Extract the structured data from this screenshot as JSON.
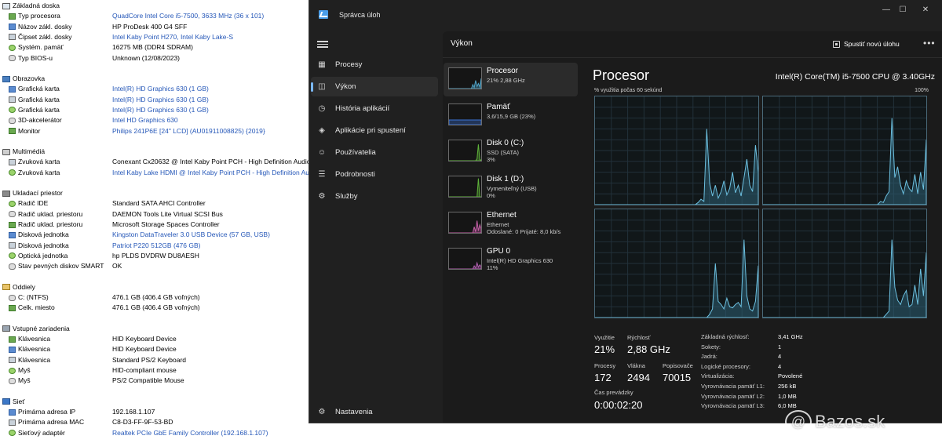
{
  "sysinfo": {
    "sections": [
      {
        "title": "Základná doska",
        "icon": "motherboard-icon",
        "props": [
          {
            "label": "Typ procesora",
            "value": "QuadCore Intel Core i5-7500, 3633 MHz (36 x 101)",
            "link": true
          },
          {
            "label": "Názov zákl. dosky",
            "value": "HP ProDesk 400 G4 SFF",
            "link": false
          },
          {
            "label": "Čipset zákl. dosky",
            "value": "Intel Kaby Point H270, Intel Kaby Lake-S",
            "link": true
          },
          {
            "label": "Systém. pamäť",
            "value": "16275 MB  (DDR4 SDRAM)",
            "link": false
          },
          {
            "label": "Typ BIOS-u",
            "value": "Unknown (12/08/2023)",
            "link": false
          }
        ]
      },
      {
        "title": "Obrazovka",
        "icon": "monitor-icon",
        "props": [
          {
            "label": "Grafická karta",
            "value": "Intel(R) HD Graphics 630  (1 GB)",
            "link": true
          },
          {
            "label": "Grafická karta",
            "value": "Intel(R) HD Graphics 630  (1 GB)",
            "link": true
          },
          {
            "label": "Grafická karta",
            "value": "Intel(R) HD Graphics 630  (1 GB)",
            "link": true
          },
          {
            "label": "3D-akcelerátor",
            "value": "Intel HD Graphics 630",
            "link": true
          },
          {
            "label": "Monitor",
            "value": "Philips 241P6E  [24\" LCD]  (AU01911008825)  {2019}",
            "link": true
          }
        ]
      },
      {
        "title": "Multimédiá",
        "icon": "speaker-icon",
        "props": [
          {
            "label": "Zvuková karta",
            "value": "Conexant Cx20632 @ Intel Kaby Point PCH - High Definition Audio...",
            "link": false
          },
          {
            "label": "Zvuková karta",
            "value": "Intel Kaby Lake HDMI @ Intel Kaby Point PCH - High Definition Au...",
            "link": true
          }
        ]
      },
      {
        "title": "Ukladací priestor",
        "icon": "storage-icon",
        "props": [
          {
            "label": "Radič IDE",
            "value": "Standard SATA AHCI Controller",
            "link": false
          },
          {
            "label": "Radič uklad. priestoru",
            "value": "DAEMON Tools Lite Virtual SCSI Bus",
            "link": false
          },
          {
            "label": "Radič uklad. priestoru",
            "value": "Microsoft Storage Spaces Controller",
            "link": false
          },
          {
            "label": "Disková jednotka",
            "value": "Kingston DataTraveler 3.0 USB Device  (57 GB, USB)",
            "link": true
          },
          {
            "label": "Disková jednotka",
            "value": "Patriot P220 512GB  (476 GB)",
            "link": true
          },
          {
            "label": "Optická jednotka",
            "value": "hp PLDS DVDRW  DU8AESH",
            "link": false
          },
          {
            "label": "Stav pevných diskov SMART",
            "value": "OK",
            "link": false
          }
        ]
      },
      {
        "title": "Oddiely",
        "icon": "partition-icon",
        "props": [
          {
            "label": "C: (NTFS)",
            "value": "476.1 GB (406.4 GB voľných)",
            "link": false
          },
          {
            "label": "Celk. miesto",
            "value": "476.1 GB (406.4 GB voľných)",
            "link": false
          }
        ]
      },
      {
        "title": "Vstupné zariadenia",
        "icon": "input-devices-icon",
        "props": [
          {
            "label": "Klávesnica",
            "value": "HID Keyboard Device",
            "link": false
          },
          {
            "label": "Klávesnica",
            "value": "HID Keyboard Device",
            "link": false
          },
          {
            "label": "Klávesnica",
            "value": "Standard PS/2 Keyboard",
            "link": false
          },
          {
            "label": "Myš",
            "value": "HID-compliant mouse",
            "link": false
          },
          {
            "label": "Myš",
            "value": "PS/2 Compatible Mouse",
            "link": false
          }
        ]
      },
      {
        "title": "Sieť",
        "icon": "network-icon",
        "props": [
          {
            "label": "Primárna adresa IP",
            "value": "192.168.1.107",
            "link": false
          },
          {
            "label": "Primárna adresa MAC",
            "value": "C8-D3-FF-9F-53-BD",
            "link": false
          },
          {
            "label": "Sieťový adaptér",
            "value": "Realtek PCIe GbE Family Controller  (192.168.1.107)",
            "link": true
          }
        ]
      }
    ]
  },
  "taskmanager": {
    "title": "Správca úloh",
    "window_buttons": {
      "min": "—",
      "max": "☐",
      "close": "✕"
    },
    "nav": [
      {
        "label": "Procesy",
        "icon": "processes-icon",
        "active": false
      },
      {
        "label": "Výkon",
        "icon": "performance-icon",
        "active": true
      },
      {
        "label": "História aplikácií",
        "icon": "history-icon",
        "active": false
      },
      {
        "label": "Aplikácie pri spustení",
        "icon": "startup-icon",
        "active": false
      },
      {
        "label": "Používatelia",
        "icon": "users-icon",
        "active": false
      },
      {
        "label": "Podrobnosti",
        "icon": "details-icon",
        "active": false
      },
      {
        "label": "Služby",
        "icon": "services-icon",
        "active": false
      }
    ],
    "settings_label": "Nastavenia",
    "view_title": "Výkon",
    "run_task_label": "Spustiť novú úlohu",
    "more_label": "•••",
    "devices": [
      {
        "name": "Procesor",
        "lines": [
          "21% 2,88 GHz"
        ],
        "active": true,
        "color": "#4fa3c7"
      },
      {
        "name": "Pamäť",
        "lines": [
          "3,6/15,9 GB (23%)"
        ],
        "active": false,
        "color": "#3b73d6"
      },
      {
        "name": "Disk 0 (C:)",
        "lines": [
          "SSD (SATA)",
          "3%"
        ],
        "active": false,
        "color": "#5fb33a"
      },
      {
        "name": "Disk 1 (D:)",
        "lines": [
          "Vymeniteľný (USB)",
          "0%"
        ],
        "active": false,
        "color": "#5fb33a"
      },
      {
        "name": "Ethernet",
        "lines": [
          "Ethernet",
          "Odoslané: 0 Prijaté: 8,0 kb/s"
        ],
        "active": false,
        "color": "#c25ea5"
      },
      {
        "name": "GPU 0",
        "lines": [
          "Intel(R) HD Graphics 630",
          "11%"
        ],
        "active": false,
        "color": "#b25fb0"
      }
    ],
    "cpu": {
      "title": "Procesor",
      "model": "Intel(R) Core(TM) i5-7500 CPU @ 3.40GHz",
      "graph_label": "% využitia počas 60 sekúnd",
      "graph_max": "100%",
      "utilization_label": "Využitie",
      "utilization": "21%",
      "speed_label": "Rýchlosť",
      "speed": "2,88 GHz",
      "processes_label": "Procesy",
      "processes": "172",
      "threads_label": "Vlákna",
      "threads": "2494",
      "handles_label": "Popisovače",
      "handles": "70015",
      "uptime_label": "Čas prevádzky",
      "uptime": "0:00:02:20",
      "specs": [
        {
          "k": "Základná rýchlosť:",
          "v": "3,41 GHz"
        },
        {
          "k": "Sokety:",
          "v": "1"
        },
        {
          "k": "Jadrá:",
          "v": "4"
        },
        {
          "k": "Logické procesory:",
          "v": "4"
        },
        {
          "k": "Virtualizácia:",
          "v": "Povolené"
        },
        {
          "k": "Vyrovnávacia pamäť L1:",
          "v": "256 kB"
        },
        {
          "k": "Vyrovnávacia pamäť L2:",
          "v": "1,0 MB"
        },
        {
          "k": "Vyrovnávacia pamäť L3:",
          "v": "6,0 MB"
        }
      ],
      "core_series": [
        [
          0,
          0,
          0,
          0,
          0,
          0,
          0,
          0,
          0,
          0,
          0,
          0,
          0,
          0,
          0,
          0,
          0,
          0,
          0,
          0,
          0,
          0,
          0,
          0,
          0,
          0,
          0,
          0,
          0,
          0,
          0,
          0,
          0,
          0,
          0,
          0,
          2,
          5,
          3,
          70,
          20,
          8,
          18,
          6,
          12,
          22,
          9,
          15,
          30,
          11,
          18,
          8,
          25,
          42,
          18,
          12,
          55,
          30
        ],
        [
          0,
          0,
          0,
          0,
          0,
          0,
          0,
          0,
          0,
          0,
          0,
          0,
          0,
          0,
          0,
          0,
          0,
          0,
          0,
          0,
          0,
          0,
          0,
          0,
          0,
          0,
          0,
          0,
          0,
          0,
          0,
          0,
          0,
          0,
          0,
          0,
          0,
          0,
          0,
          0,
          0,
          3,
          2,
          8,
          12,
          80,
          25,
          35,
          18,
          10,
          22,
          15,
          12,
          28,
          10,
          30,
          14,
          60
        ],
        [
          0,
          0,
          0,
          0,
          0,
          0,
          0,
          0,
          0,
          0,
          0,
          0,
          0,
          0,
          0,
          0,
          0,
          0,
          0,
          0,
          0,
          0,
          0,
          0,
          0,
          0,
          0,
          0,
          0,
          0,
          0,
          0,
          0,
          0,
          0,
          0,
          0,
          0,
          0,
          0,
          3,
          8,
          50,
          15,
          12,
          8,
          18,
          10,
          9,
          12,
          14,
          10,
          72,
          20,
          8,
          6,
          15,
          48
        ],
        [
          0,
          0,
          0,
          0,
          0,
          0,
          0,
          0,
          0,
          0,
          0,
          0,
          0,
          0,
          0,
          0,
          0,
          0,
          0,
          0,
          0,
          0,
          0,
          0,
          0,
          0,
          0,
          0,
          0,
          0,
          0,
          0,
          0,
          0,
          0,
          0,
          0,
          0,
          0,
          0,
          0,
          0,
          0,
          3,
          6,
          72,
          28,
          16,
          12,
          20,
          25,
          10,
          12,
          30,
          12,
          45,
          20,
          60
        ]
      ]
    }
  },
  "watermark": {
    "logo": "@",
    "text": "Bazos.sk"
  }
}
